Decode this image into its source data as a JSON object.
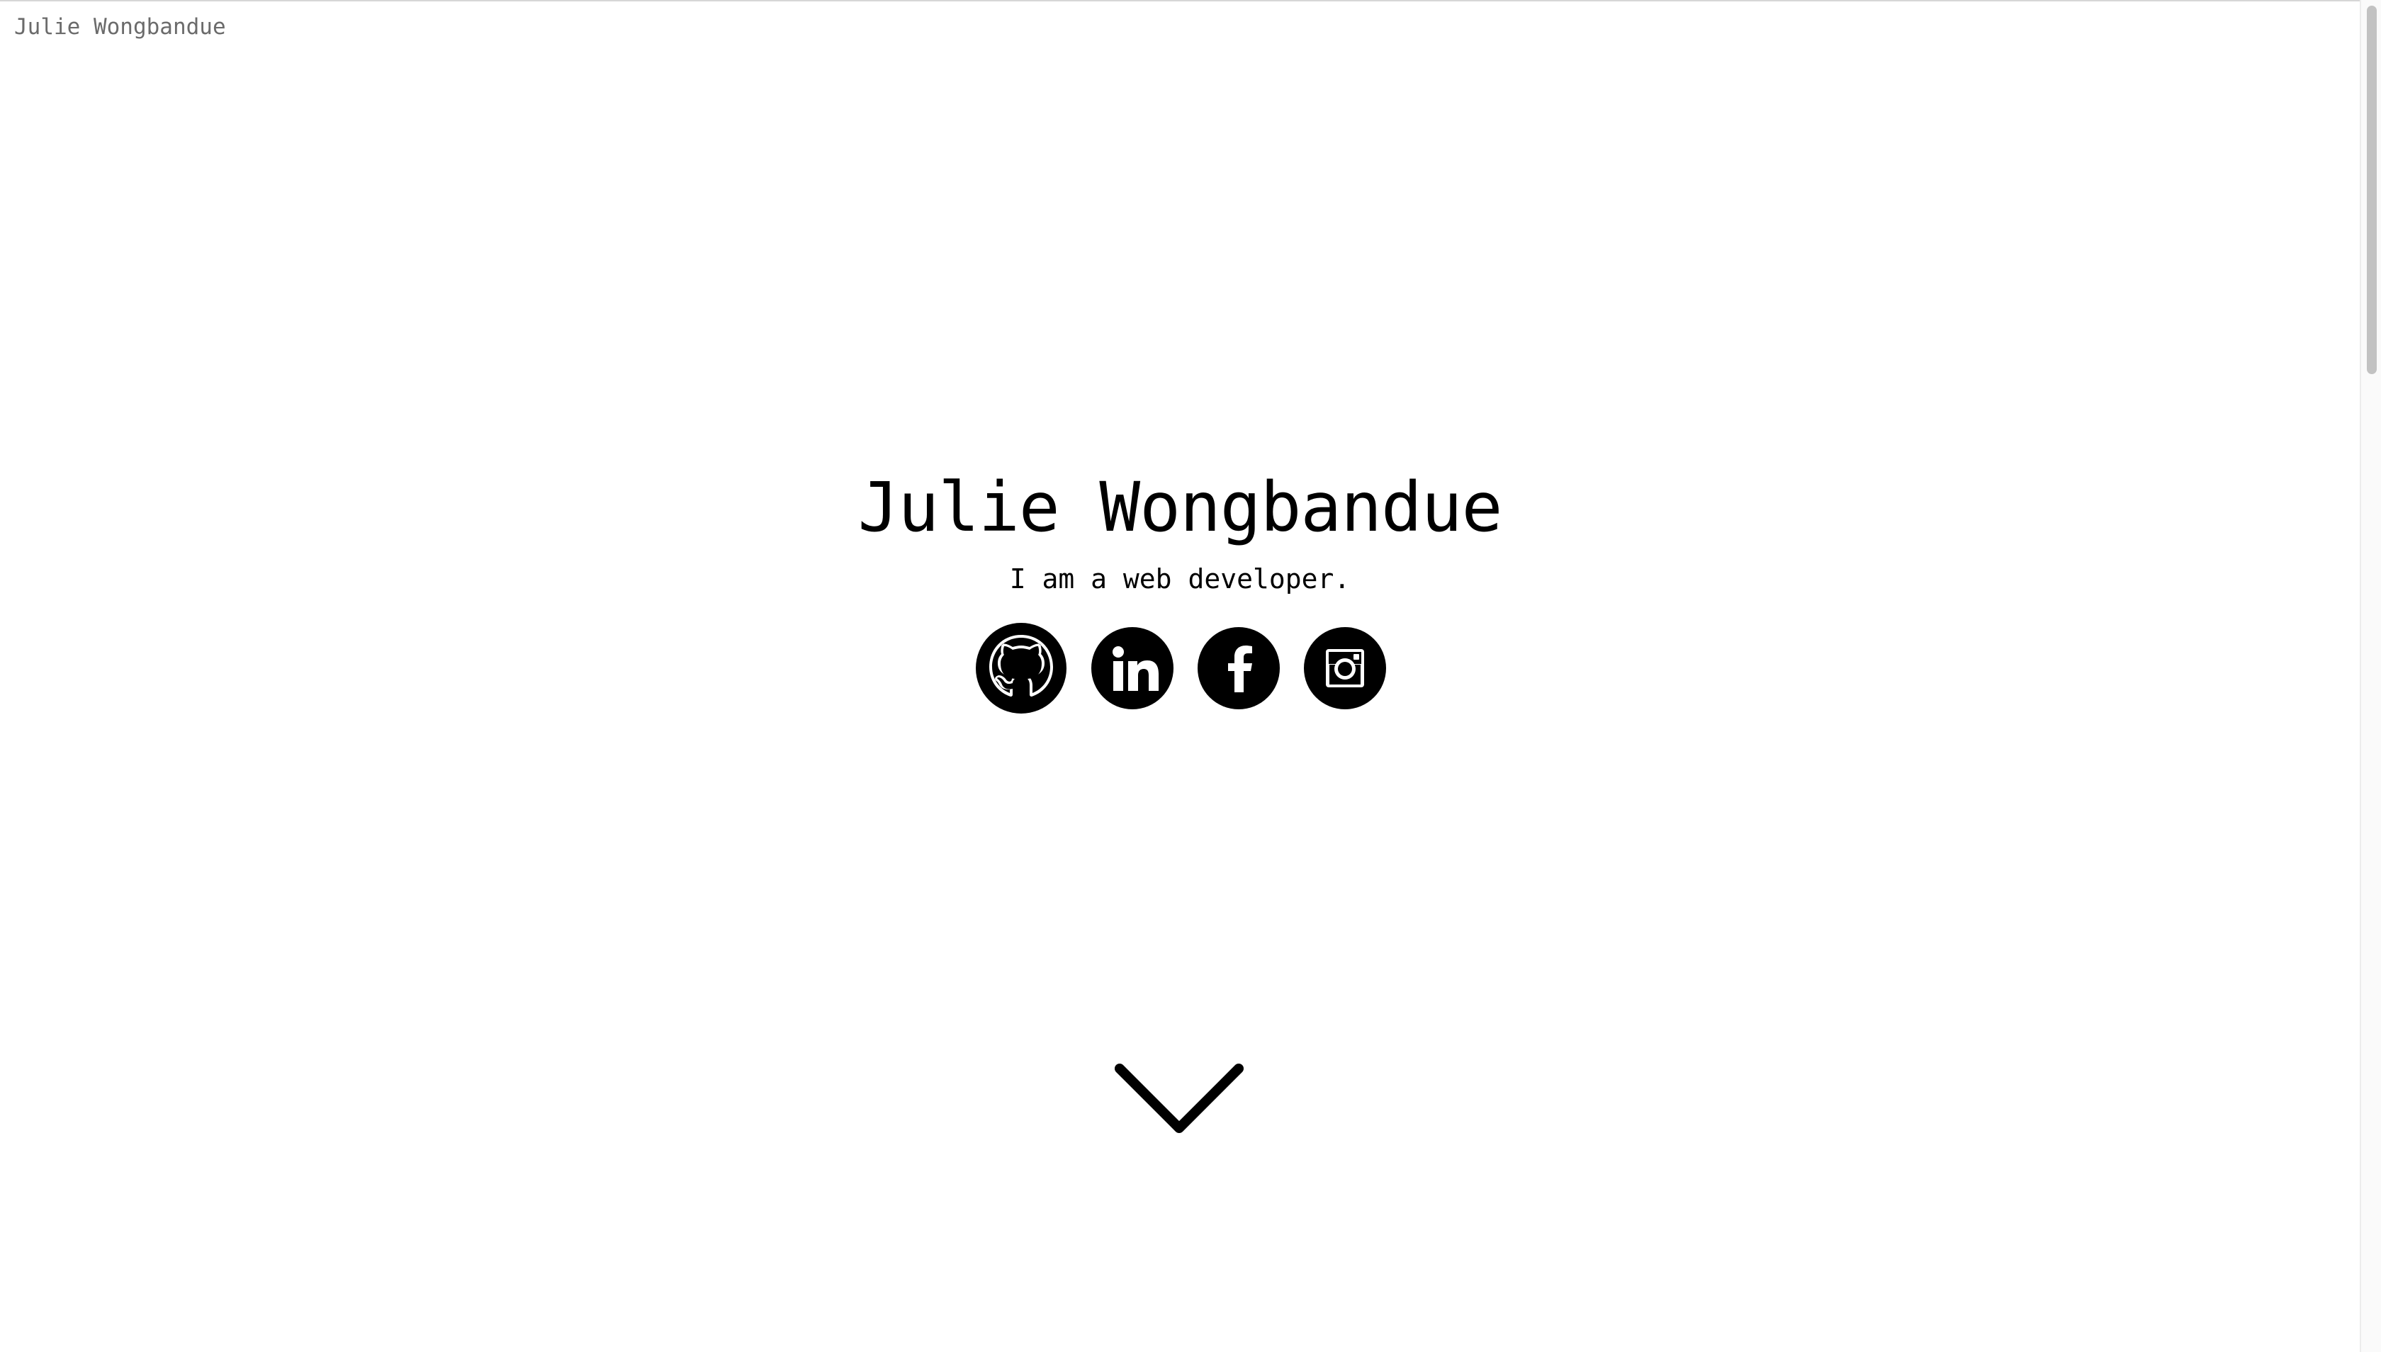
{
  "header": {
    "site_name": "Julie Wongbandue"
  },
  "hero": {
    "title": "Julie Wongbandue",
    "subtitle": "I am a web developer."
  },
  "social_links": [
    {
      "name": "GitHub",
      "icon": "github-icon"
    },
    {
      "name": "LinkedIn",
      "icon": "linkedin-icon"
    },
    {
      "name": "Facebook",
      "icon": "facebook-icon"
    },
    {
      "name": "Instagram",
      "icon": "instagram-icon"
    }
  ],
  "scroll_indicator": {
    "icon": "chevron-down-icon"
  },
  "colors": {
    "background": "#ffffff",
    "text": "#000000",
    "header_text": "#6b6b6b",
    "icon_fill": "#000000"
  }
}
